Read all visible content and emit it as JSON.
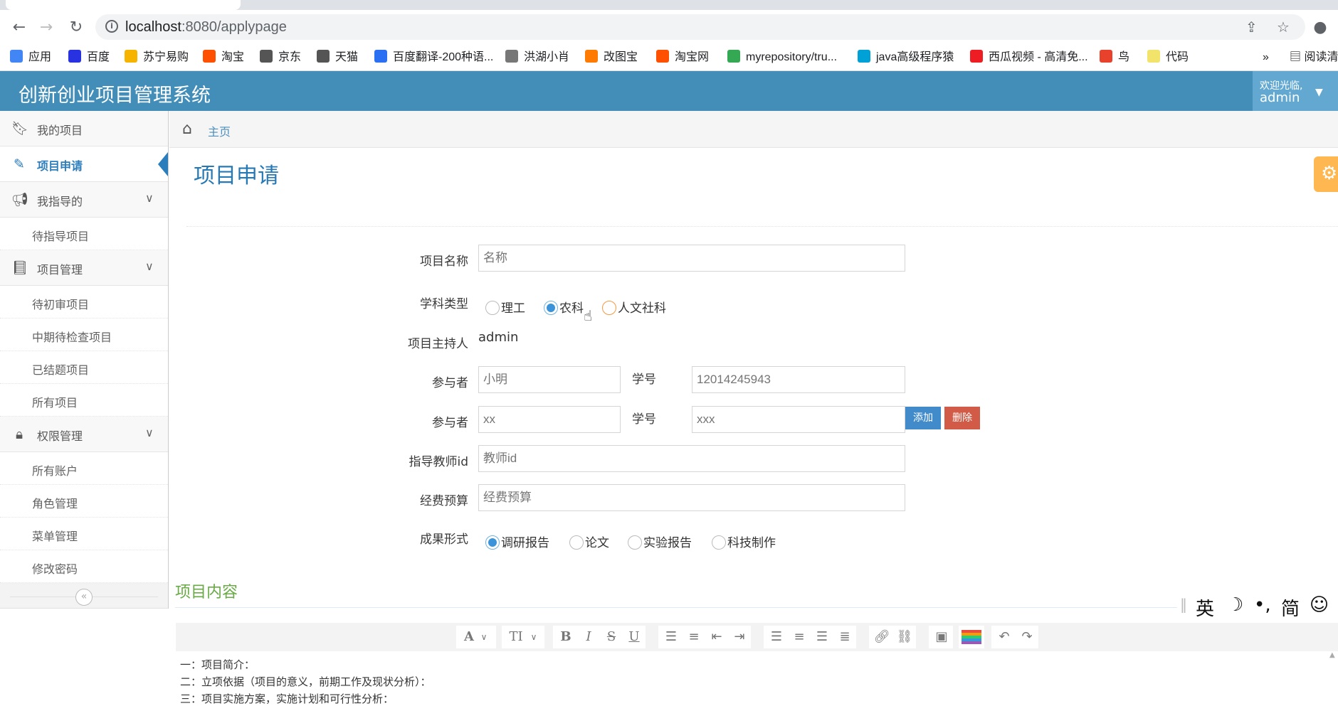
{
  "browser": {
    "url_host": "localhost",
    "url_rest": ":8080/applypage",
    "bookmarks": [
      {
        "label": "应用",
        "color": "#4285f4"
      },
      {
        "label": "百度",
        "color": "#2932e1"
      },
      {
        "label": "苏宁易购",
        "color": "#f6b400"
      },
      {
        "label": "淘宝",
        "color": "#ff5000"
      },
      {
        "label": "京东",
        "color": "#555555"
      },
      {
        "label": "天猫",
        "color": "#555555"
      },
      {
        "label": "百度翻译-200种语...",
        "color": "#2b6ff3"
      },
      {
        "label": "洪湖小肖",
        "color": "#777777"
      },
      {
        "label": "改图宝",
        "color": "#ff7a00"
      },
      {
        "label": "淘宝网",
        "color": "#ff5000"
      },
      {
        "label": "myrepository/tru...",
        "color": "#34a853"
      },
      {
        "label": "java高级程序猿",
        "color": "#00a1d6"
      },
      {
        "label": "西瓜视频 - 高清免...",
        "color": "#ee1d24"
      },
      {
        "label": "鸟",
        "color": "#e8412c"
      },
      {
        "label": "代码",
        "color": "#f2e36b"
      }
    ],
    "more": "»",
    "reading_list": "阅读清"
  },
  "header": {
    "title": "创新创业项目管理系统",
    "welcome": "欢迎光临,",
    "username": "admin",
    "accent": "#438eb9"
  },
  "sidebar": {
    "items": [
      {
        "label": "我的项目",
        "icon": "bookmark-icon"
      },
      {
        "label": "项目申请",
        "icon": "edit-icon"
      },
      {
        "label": "我指导的",
        "icon": "bullhorn-icon"
      },
      {
        "label": "项目管理",
        "icon": "book-icon"
      },
      {
        "label": "权限管理",
        "icon": "lock-icon"
      }
    ],
    "guided_sub": [
      "待指导项目"
    ],
    "manage_sub": [
      "待初审项目",
      "中期待检查项目",
      "已结题项目",
      "所有项目"
    ],
    "perm_sub": [
      "所有账户",
      "角色管理",
      "菜单管理",
      "修改密码"
    ],
    "collapse_glyph": "«"
  },
  "breadcrumb": {
    "home": "主页"
  },
  "page": {
    "title": "项目申请",
    "form": {
      "name_label": "项目名称",
      "name_placeholder": "名称",
      "subject_label": "学科类型",
      "subject_options": [
        "理工",
        "农科",
        "人文社科"
      ],
      "subject_selected": "农科",
      "host_label": "项目主持人",
      "host_value": "admin",
      "participant_label": "参与者",
      "student_id_label": "学号",
      "participants": [
        {
          "name": "小明",
          "student_id": "12014245943"
        },
        {
          "name": "xx",
          "student_id": "xxx"
        }
      ],
      "add_label": "添加",
      "delete_label": "删除",
      "teacher_label": "指导教师id",
      "teacher_placeholder": "教师id",
      "budget_label": "经费预算",
      "budget_placeholder": "经费预算",
      "result_label": "成果形式",
      "result_options": [
        "调研报告",
        "论文",
        "实验报告",
        "科技制作"
      ],
      "result_selected": "调研报告"
    },
    "content_title": "项目内容",
    "editor_lines": [
      "一：项目简介：",
      "二：立项依据（项目的意义，前期工作及现状分析）：",
      "三：项目实施方案，实施计划和可行性分析："
    ]
  },
  "ime": {
    "lang": "英",
    "moon": "☽",
    "punct": "•,",
    "simp": "简",
    "emoji": "☺"
  }
}
